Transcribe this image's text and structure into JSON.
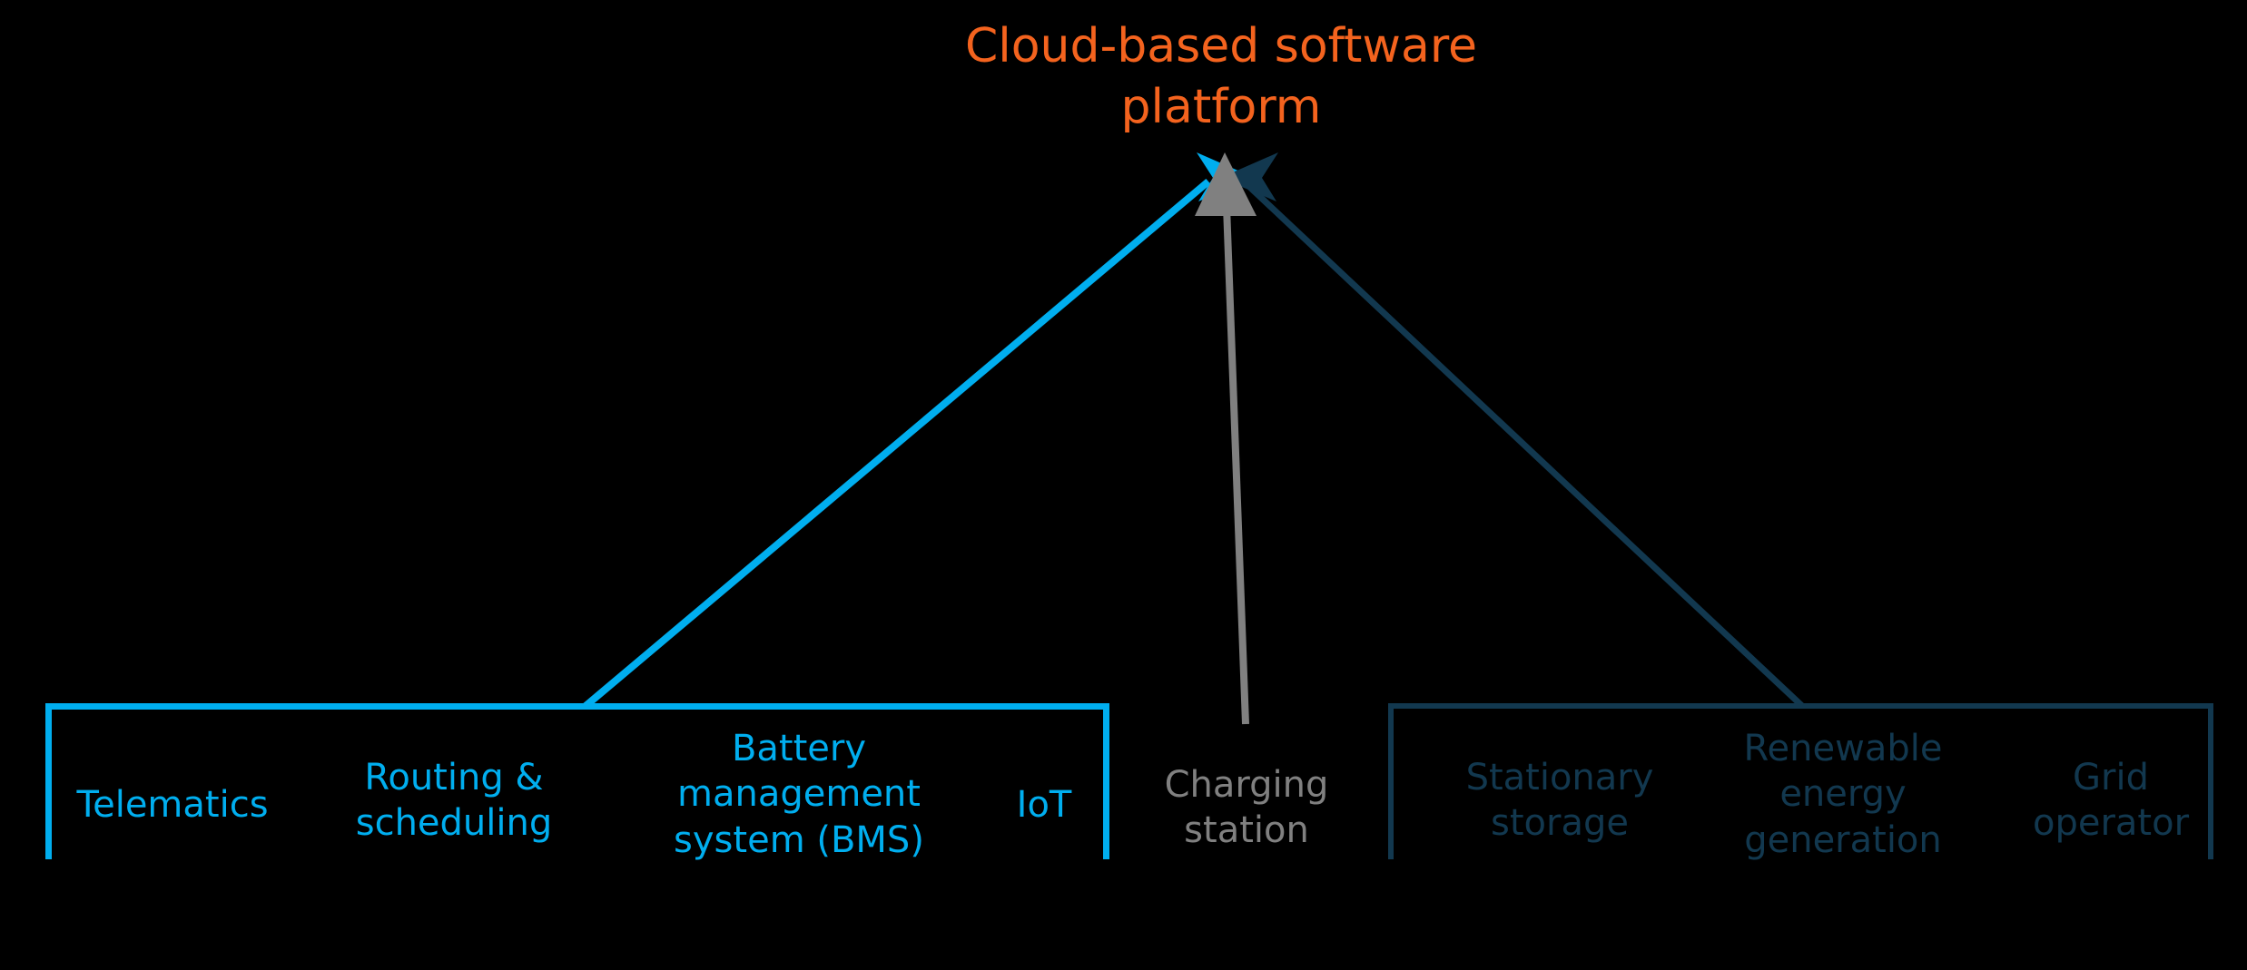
{
  "diagram": {
    "background_color": "#000000",
    "title": {
      "text": "Cloud-based software\nplatform",
      "color": "#F4631E"
    },
    "connectors": [
      {
        "name": "vehicle-systems-to-platform",
        "color": "#00AEEF",
        "from": "vehicle-systems-group",
        "to": "cloud-based-software-platform",
        "direction": "upward-right"
      },
      {
        "name": "charging-station-to-platform",
        "color": "#808080",
        "from": "charging-station",
        "to": "cloud-based-software-platform",
        "direction": "upward"
      },
      {
        "name": "grid-assets-to-platform",
        "color": "#12384F",
        "from": "grid-assets-group",
        "to": "cloud-based-software-platform",
        "direction": "upward-left"
      }
    ],
    "groups": [
      {
        "name": "vehicle-systems-group",
        "color": "#00AEEF",
        "items": [
          {
            "label": "Telematics"
          },
          {
            "label": "Routing &\nscheduling"
          },
          {
            "label": "Battery\nmanagement\nsystem (BMS)"
          },
          {
            "label": "IoT"
          }
        ]
      },
      {
        "name": "charging-group",
        "color": "#808080",
        "bracket": false,
        "items": [
          {
            "label": "Charging\nstation"
          }
        ]
      },
      {
        "name": "grid-assets-group",
        "color": "#12384F",
        "items": [
          {
            "label": "Stationary\nstorage"
          },
          {
            "label": "Renewable\nenergy\ngeneration"
          },
          {
            "label": "Grid\noperator"
          }
        ]
      }
    ]
  }
}
